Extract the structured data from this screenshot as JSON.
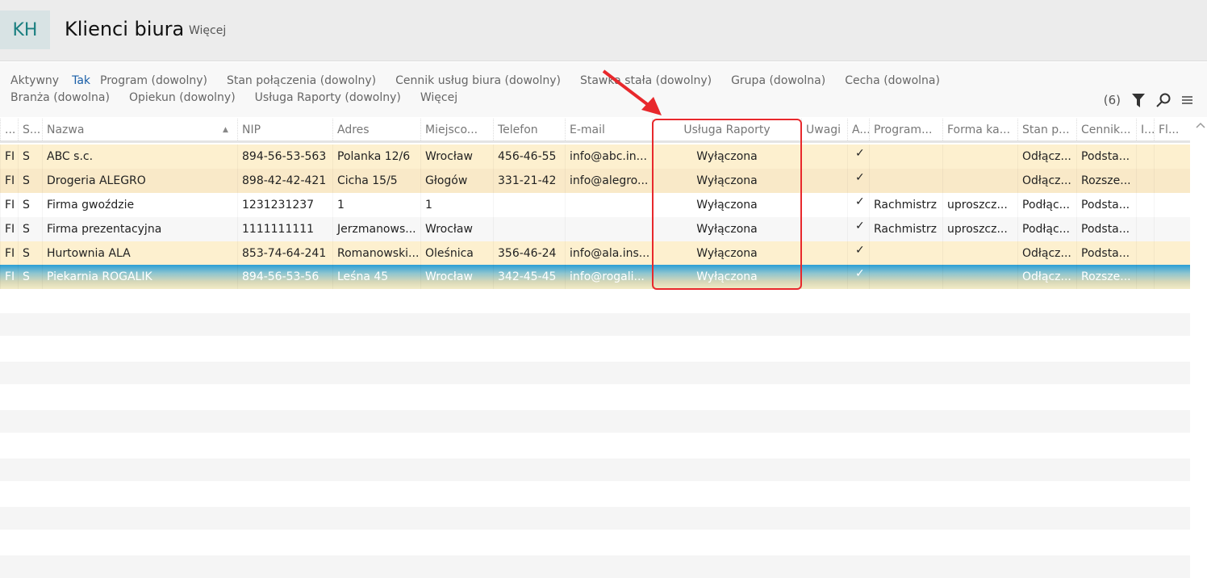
{
  "header": {
    "logo": "KH",
    "title": "Klienci biura",
    "more": "Więcej"
  },
  "filters": {
    "row1": [
      {
        "label": "Aktywny",
        "value": "Tak"
      },
      {
        "label": "Program (dowolny)"
      },
      {
        "label": "Stan połączenia (dowolny)"
      },
      {
        "label": "Cennik usług biura (dowolny)"
      },
      {
        "label": "Stawka stała (dowolny)"
      },
      {
        "label": "Grupa (dowolna)"
      },
      {
        "label": "Cecha (dowolna)"
      }
    ],
    "row2": [
      {
        "label": "Branża (dowolna)"
      },
      {
        "label": "Opiekun (dowolny)"
      },
      {
        "label": "Usługa Raporty (dowolny)"
      },
      {
        "label": "Więcej"
      }
    ]
  },
  "tools": {
    "count": "(6)",
    "icons": [
      "filter-icon",
      "search-icon",
      "menu-icon"
    ]
  },
  "table": {
    "columns": [
      "...",
      "S...",
      "Nazwa",
      "NIP",
      "Adres",
      "Miejsco...",
      "Telefon",
      "E-mail",
      "Usługa Raporty",
      "Uwagi",
      "A...",
      "Program...",
      "Forma ka...",
      "Stan p...",
      "Cennik...",
      "I...",
      "Fl..."
    ],
    "sort": {
      "column": "Nazwa",
      "direction": "asc"
    },
    "rows": [
      [
        "FI",
        "S",
        "ABC s.c.",
        "894-56-53-563",
        "Polanka  12/6",
        "Wrocław",
        "456-46-55",
        "info@abc.in...",
        "Wyłączona",
        "",
        "✓",
        "",
        "",
        "Odłącz...",
        "Podsta...",
        "",
        ""
      ],
      [
        "FI",
        "S",
        "Drogeria ALEGRO",
        "898-42-42-421",
        "Cicha  15/5",
        "Głogów",
        "331-21-42",
        "info@alegro...",
        "Wyłączona",
        "",
        "✓",
        "",
        "",
        "Odłącz...",
        "Rozsze...",
        "",
        ""
      ],
      [
        "FI",
        "S",
        "Firma gwoździe",
        "1231231237",
        "1",
        "1",
        "",
        "",
        "Wyłączona",
        "",
        "✓",
        "Rachmistrz",
        "uproszcz...",
        "Podłąc...",
        "Podsta...",
        "",
        ""
      ],
      [
        "FI",
        "S",
        "Firma prezentacyjna",
        "1111111111",
        "Jerzmanows...",
        "Wrocław",
        "",
        "",
        "Wyłączona",
        "",
        "✓",
        "Rachmistrz",
        "uproszcz...",
        "Podłąc...",
        "Podsta...",
        "",
        ""
      ],
      [
        "FI",
        "S",
        "Hurtownia ALA",
        "853-74-64-241",
        "Romanowski...",
        "Oleśnica",
        "356-46-24",
        "info@ala.ins...",
        "Wyłączona",
        "",
        "✓",
        "",
        "",
        "Odłącz...",
        "Podsta...",
        "",
        ""
      ],
      [
        "FI",
        "S",
        "Piekarnia ROGALIK",
        "894-56-53-56",
        "Leśna  45",
        "Wrocław",
        "342-45-45",
        "info@rogali...",
        "Wyłączona",
        "",
        "✓",
        "",
        "",
        "Odłącz...",
        "Rozsze...",
        "",
        ""
      ]
    ],
    "selected_row": 5,
    "highlighted_column": "Usługa Raporty"
  },
  "colors": {
    "accent": "#1a7f80",
    "highlight_box": "#e8282c",
    "row_yellow": "#fdf0cf",
    "selection": "#2a9fd6"
  }
}
